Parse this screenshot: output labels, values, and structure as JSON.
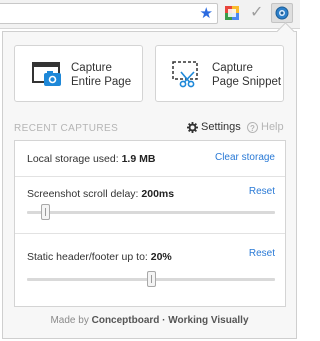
{
  "toolbar": {
    "star_icon": "star-icon",
    "check_icon": "check-icon",
    "colors": {
      "star": "#2b6be0"
    }
  },
  "capture": {
    "entire_page": {
      "line1": "Capture",
      "line2": "Entire Page"
    },
    "snippet": {
      "line1": "Capture",
      "line2": "Page Snippet"
    }
  },
  "section_title": "RECENT CAPTURES",
  "settings_label": "Settings",
  "help_label": "Help",
  "storage": {
    "label": "Local storage used:",
    "value": "1.9 MB",
    "action": "Clear storage"
  },
  "scroll_delay": {
    "label": "Screenshot scroll delay:",
    "value": "200ms",
    "action": "Reset",
    "level_fraction": 0.06
  },
  "static_header": {
    "label": "Static header/footer up to:",
    "value": "20%",
    "action": "Reset",
    "level_fraction": 0.5
  },
  "footer": {
    "prefix": "Made by",
    "brand": "Conceptboard",
    "separator": "·",
    "tagline": "Working Visually"
  },
  "colors": {
    "link": "#2a7ad6",
    "icon_blue": "#1e88d8"
  }
}
